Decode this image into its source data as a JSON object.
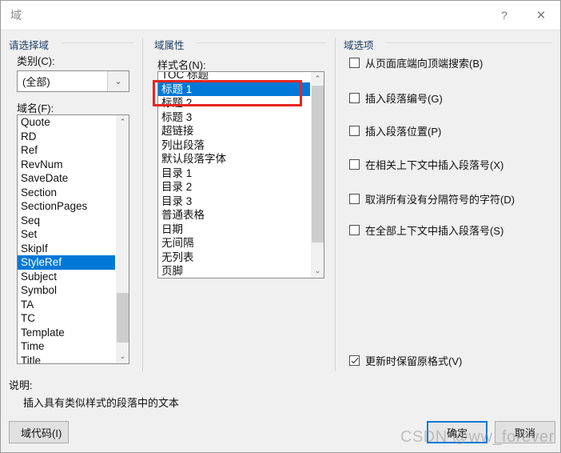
{
  "window": {
    "title": "域",
    "help_icon": "?",
    "close_icon": "✕"
  },
  "left_panel": {
    "group_label": "请选择域",
    "category_label": "类别(C):",
    "category_value": "(全部)",
    "category_arrow_icon": "⌄",
    "fieldname_label": "域名(F):",
    "field_items": [
      "Quote",
      "RD",
      "Ref",
      "RevNum",
      "SaveDate",
      "Section",
      "SectionPages",
      "Seq",
      "Set",
      "SkipIf",
      "StyleRef",
      "Subject",
      "Symbol",
      "TA",
      "TC",
      "Template",
      "Time",
      "Title"
    ],
    "selected_field": "StyleRef",
    "scroll_up_icon": "⌃",
    "scroll_down_icon": "⌄"
  },
  "middle_panel": {
    "group_label": "域属性",
    "stylename_label": "样式名(N):",
    "style_items": [
      "TOC 标题",
      "标题 1",
      "标题 2",
      "标题 3",
      "超链接",
      "列出段落",
      "默认段落字体",
      "目录 1",
      "目录 2",
      "目录 3",
      "普通表格",
      "日期",
      "无间隔",
      "无列表",
      "页脚"
    ],
    "selected_style": "标题 1",
    "scroll_up_icon": "⌃",
    "scroll_down_icon": "⌄"
  },
  "right_panel": {
    "group_label": "域选项",
    "options": [
      {
        "label": "从页面底端向顶端搜索(B)",
        "checked": false
      },
      {
        "label": "插入段落编号(G)",
        "checked": false
      },
      {
        "label": "插入段落位置(P)",
        "checked": false
      },
      {
        "label": "在相关上下文中插入段落号(X)",
        "checked": false
      },
      {
        "label": "取消所有没有分隔符号的字符(D)",
        "checked": false
      },
      {
        "label": "在全部上下文中插入段落号(S)",
        "checked": false
      }
    ],
    "preserve_format": {
      "label": "更新时保留原格式(V)",
      "checked": true
    }
  },
  "footer": {
    "description_label": "说明:",
    "description_text": "插入具有类似样式的段落中的文本",
    "field_code_button": "域代码(I)",
    "ok_button": "确定",
    "cancel_button": "取消"
  },
  "watermark": "CSDN @ww_forever",
  "colors": {
    "selection_blue": "#0078d7",
    "annotation_red": "#e8251f",
    "dialog_bg": "#f0f0f0",
    "group_label": "#1f3f66"
  }
}
